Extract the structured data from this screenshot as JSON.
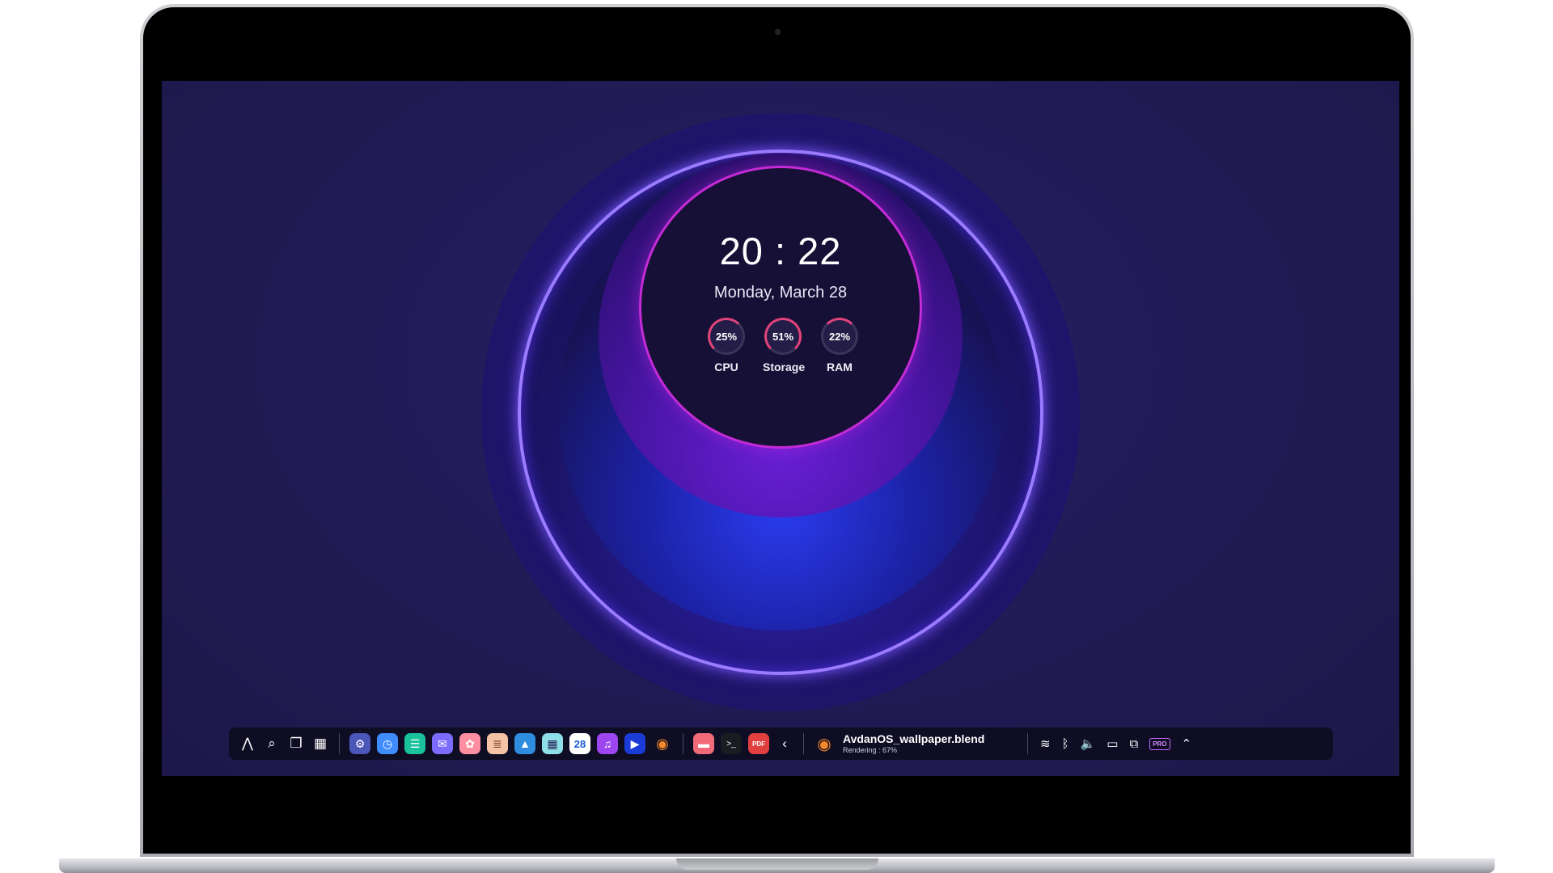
{
  "widget": {
    "time": "20 : 22",
    "date": "Monday, March 28",
    "gauges": [
      {
        "value": "25%",
        "label": "CPU",
        "fraction": 0.25
      },
      {
        "value": "51%",
        "label": "Storage",
        "fraction": 0.51
      },
      {
        "value": "22%",
        "label": "RAM",
        "fraction": 0.22
      }
    ]
  },
  "taskbar": {
    "task": {
      "title": "AvdanOS_wallpaper.blend",
      "status": "Rendering :   67%"
    },
    "calendar_day": "28",
    "pdf_label": "PDF",
    "pro_label": "PRO"
  },
  "colors": {
    "accent": "#c32bd6",
    "wallpaper": "#221b57",
    "taskbar": "#0e0d24",
    "gauge": "#e0447a"
  }
}
